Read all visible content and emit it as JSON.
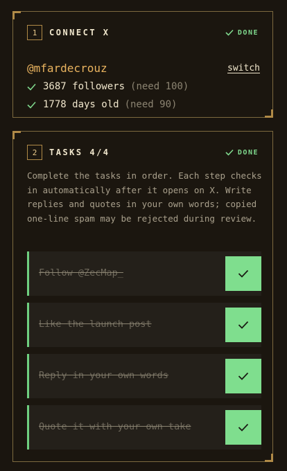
{
  "connect": {
    "step": "1",
    "title": "CONNECT X",
    "status": "DONE",
    "handle": "@mfardecrouz",
    "switch_label": "switch",
    "stats": [
      {
        "value": "3687 followers",
        "need": "(need 100)"
      },
      {
        "value": "1778 days old",
        "need": "(need 90)"
      }
    ]
  },
  "tasks": {
    "step": "2",
    "title": "TASKS 4/4",
    "status": "DONE",
    "description": "Complete the tasks in order. Each step checks in automatically after it opens on X. Write replies and quotes in your own words; copied one-line spam may be rejected during review.",
    "items": [
      {
        "label": "Follow @ZecMap_",
        "completed": true
      },
      {
        "label": "Like the launch post",
        "completed": true
      },
      {
        "label": "Reply in your own words",
        "completed": true
      },
      {
        "label": "Quote it with your own take",
        "completed": true
      }
    ]
  },
  "colors": {
    "accent_green": "#7fde8e",
    "accent_gold": "#b08a47",
    "handle_orange": "#e9b35f",
    "background": "#1a150f"
  },
  "icons": {
    "status": "check-icon",
    "stat": "check-icon",
    "task_button": "check-icon"
  }
}
